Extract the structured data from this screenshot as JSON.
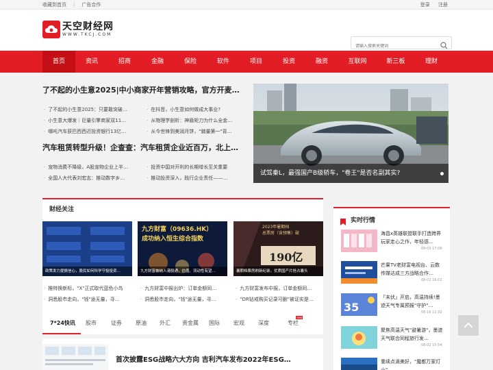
{
  "topbar": {
    "bookmark": "收藏到首页",
    "ads": "广告合作",
    "login": "登录",
    "register": "注册"
  },
  "logo": {
    "cn": "天空财经网",
    "en": "WWW.TKCJ.COM"
  },
  "search": {
    "placeholder": "请输入搜索关键词"
  },
  "nav": [
    "首页",
    "资讯",
    "招商",
    "金融",
    "保险",
    "软件",
    "项目",
    "投资",
    "融资",
    "互联网",
    "新三板",
    "理财"
  ],
  "headline1": {
    "title": "了不起的小生意2025|中小商家开年营销攻略，官方开麦…",
    "left": [
      "了不起的小生意2025：只要敢突破…",
      "小生意大爆发｜巨量引擎商家双11…",
      "哪吒汽车获巴西西近投资银行13亿…"
    ],
    "right": [
      "在抖音，小生意如何做成大事业?",
      "从物理学剖析：神盾矩刀为什么全金…",
      "从今世锋到美润月饼，\"銷量第一\"背…"
    ]
  },
  "headline2": {
    "title": "汽车租赁转型升级！企查查：汽车租赁企业近百万，北上…",
    "left": [
      "宠物消费不降级，A股宠物企业上半…",
      "全国人大代表刘宏志：推动数字乡…"
    ],
    "right": [
      "投资中国对开利的长期增长至关重要",
      "推动投资深入，践行企业责任——…"
    ]
  },
  "hero": {
    "caption": "试驾秦L，最强国产B级轿车，\"卷王\"是否名副其实?"
  },
  "focus": {
    "title": "财经关注",
    "cards": [
      {
        "caption": "政策发力提振信心，股民如何科学守投投资…"
      },
      {
        "caption": "九方财富被纳入港股通，估值、流动性有望…",
        "overlay": "九方财富（09636.HK）",
        "overlay2": "成功纳入恒生综合指数"
      },
      {
        "caption": "暑期档票房刷新纪录，优质国产片抢占暑头",
        "overlay": "2023年暑期档",
        "overlay2": "总票房（含预售）破",
        "num": "190亿"
      }
    ],
    "col1": [
      "推特换新标，\"X\"正式取代蓝色小鸟",
      "洞悉股市走向，\"钱\"途无量，寻…"
    ],
    "col2": [
      "九方财富中报出炉：订单金额同…",
      "洞悉股市走向，\"钱\"途无量，寻…"
    ],
    "col3": [
      "九方财富发布中报，订单金额同…",
      "\"DR钻戒购买记录可删\"被证实是…"
    ]
  },
  "tabs": [
    "7*24快讯",
    "股市",
    "证券",
    "原油",
    "外汇",
    "贵金属",
    "国际",
    "宏观",
    "深度",
    "专栏"
  ],
  "tab_badge": "new",
  "feed": {
    "title": "首次披露ESG战略六大方向 吉利汽车发布2022年ESG…"
  },
  "hot": {
    "title": "实时行情",
    "items": [
      {
        "title": "海昌x英雄联盟联手打造跨界玩家走心之作，年轻感…",
        "time": "09-09 17:06"
      },
      {
        "title": "芒果TV老财富电视台、云数传媒达成三方战略合作…",
        "time": "08-02 16:02"
      },
      {
        "title": "「末伏」开启，高温持续!墨迹天气专属预报\"守护\"…",
        "time": "08-16 11:32"
      },
      {
        "title": "聚焦高温天气\"避暑游\"，墨迹天气联合同程旅行发…",
        "time": "08-02 15:54"
      },
      {
        "title": "重续点滴美好，\"魔都万家灯火\"…",
        "time": ""
      }
    ]
  },
  "colors": {
    "accent": "#e21d25",
    "accent_dark": "#c50f16"
  },
  "icons": {
    "search": "search-icon",
    "cloud": "cloud-logo-icon",
    "hot": "bookmark-icon",
    "backtop": "chevron-up-icon"
  }
}
